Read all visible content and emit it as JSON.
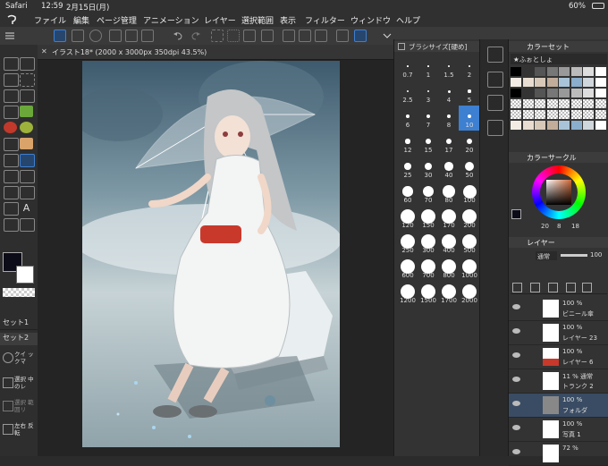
{
  "status": {
    "app": "Safari",
    "time": "12:59",
    "date": "2月15日(月)",
    "battery": "60%"
  },
  "menu": [
    "ファイル",
    "編集",
    "ページ管理",
    "アニメーション",
    "レイヤー",
    "選択範囲",
    "表示",
    "フィルター",
    "ウィンドウ",
    "ヘルプ"
  ],
  "canvas_tab": "イラスト18* (2000 x 3000px 350dpi 43.5%)",
  "left_panel": {
    "set1": "セット1",
    "set2": "セット2",
    "quick": "クイ ックマ",
    "select": "選択 中のレ",
    "select2": "選択 範囲リ",
    "flip": "左右 反転"
  },
  "brush_panel": {
    "title": "ブラシサイズ[硬め]",
    "sizes": [
      "0.7",
      "1",
      "1.5",
      "2",
      "2.5",
      "3",
      "4",
      "5",
      "6",
      "7",
      "8",
      "10",
      "12",
      "15",
      "17",
      "20",
      "25",
      "30",
      "40",
      "50",
      "60",
      "70",
      "80",
      "100",
      "120",
      "150",
      "170",
      "200",
      "250",
      "300",
      "400",
      "500",
      "600",
      "700",
      "800",
      "1000",
      "1200",
      "1500",
      "1700",
      "2000"
    ]
  },
  "color_set": {
    "title": "カラーセット",
    "name": "★ふぉとしょ"
  },
  "color_circle": {
    "title": "カラーサークル",
    "hue": "20",
    "sat": "8",
    "val": "18"
  },
  "layer_panel": {
    "title": "レイヤー",
    "blend": "通常",
    "opacity": "100",
    "layers": [
      {
        "pct": "100 %",
        "name": "ビニール傘"
      },
      {
        "pct": "100 %",
        "name": "レイヤー 23"
      },
      {
        "pct": "100 %",
        "name": "レイヤー 6"
      },
      {
        "pct": "11 % 通常",
        "name": "トランク 2"
      },
      {
        "pct": "100 %",
        "name": "フォルダ"
      },
      {
        "pct": "100 %",
        "name": "写真 1"
      },
      {
        "pct": "72 %",
        "name": ""
      }
    ]
  },
  "colors": {
    "accent": "#3d7fd1",
    "fg": "#0c0c18",
    "bg": "#ffffff"
  }
}
